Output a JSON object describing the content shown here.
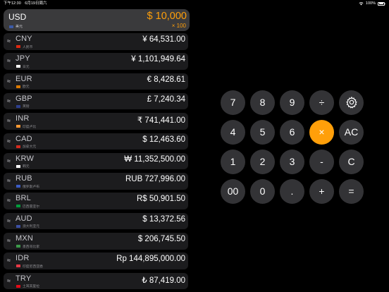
{
  "status_bar": {
    "time": "下午12:30",
    "date": "6月19日周六",
    "battery": "100%"
  },
  "base": {
    "code": "USD",
    "name": "美元",
    "amount": "$ 10,000",
    "multiplier": "× 100",
    "flag_color": "#3c5aa6"
  },
  "rows": [
    {
      "code": "CNY",
      "name": "人民币",
      "value": "¥ 64,531.00",
      "flag_color": "#de2910"
    },
    {
      "code": "JPY",
      "name": "日元",
      "value": "¥ 1,101,949.64",
      "flag_color": "#ffffff"
    },
    {
      "code": "EUR",
      "name": "欧元",
      "value": "€ 8,428.61",
      "flag_color": "#dd7a00"
    },
    {
      "code": "GBP",
      "name": "英镑",
      "value": "£ 7,240.34",
      "flag_color": "#2d3f8f"
    },
    {
      "code": "INR",
      "name": "印度卢比",
      "value": "₹ 741,441.00",
      "flag_color": "#ff9933"
    },
    {
      "code": "CAD",
      "name": "加拿大元",
      "value": "$ 12,463.60",
      "flag_color": "#d52b1e"
    },
    {
      "code": "KRW",
      "name": "韩元",
      "value": "₩ 11,352,500.00",
      "flag_color": "#ffffff"
    },
    {
      "code": "RUB",
      "name": "俄罗斯卢布",
      "value": "RUB 727,996.00",
      "flag_color": "#3b5bc4"
    },
    {
      "code": "BRL",
      "name": "巴西雷亚尔",
      "value": "R$ 50,901.50",
      "flag_color": "#009c3b"
    },
    {
      "code": "AUD",
      "name": "澳大利亚元",
      "value": "$ 13,372.56",
      "flag_color": "#3c4fa3"
    },
    {
      "code": "MXN",
      "name": "墨西哥比索",
      "value": "$ 206,745.50",
      "flag_color": "#3c9a4a"
    },
    {
      "code": "IDR",
      "name": "印度尼西亚盾",
      "value": "Rp 144,895,000.00",
      "flag_color": "#e63946"
    },
    {
      "code": "TRY",
      "name": "土耳其里拉",
      "value": "₺ 87,419.00",
      "flag_color": "#e30a17"
    }
  ],
  "keypad": {
    "row1": [
      "7",
      "8",
      "9",
      "÷",
      "settings"
    ],
    "row2": [
      "4",
      "5",
      "6",
      "×",
      "AC"
    ],
    "row3": [
      "1",
      "2",
      "3",
      "-",
      "C"
    ],
    "row4": [
      "00",
      "0",
      ".",
      "+",
      "="
    ]
  },
  "colors": {
    "accent": "#ff9f0a",
    "key": "#333336",
    "row_bg": "#1c1c1e",
    "base_bg": "#3a3a3c"
  },
  "icons": {
    "swap": "≈",
    "settings": "gear-icon"
  }
}
